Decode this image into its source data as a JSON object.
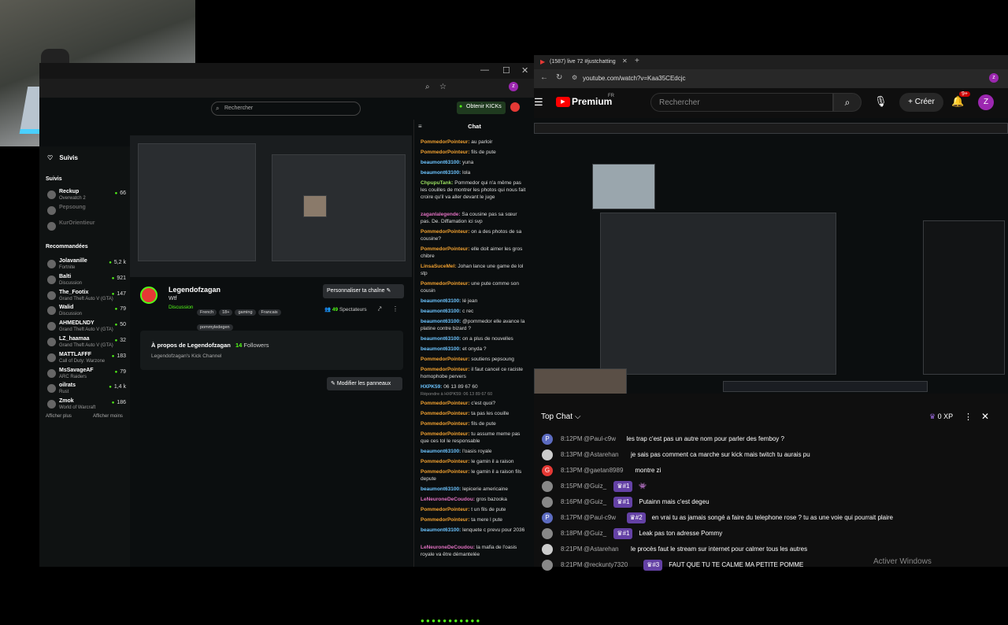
{
  "kick": {
    "search_placeholder": "Rechercher",
    "obtain_button": "Obtenir KICKs",
    "following_header": "Suivis",
    "following_section": "Suivis",
    "following": [
      {
        "name": "Reckup",
        "game": "Overwatch 2",
        "count": "66"
      },
      {
        "name": "Pepsoung",
        "game": "",
        "count": ""
      },
      {
        "name": "KurOrientieur",
        "game": "",
        "count": ""
      }
    ],
    "recommended_title": "Recommandées",
    "recommended": [
      {
        "name": "Jolavanille",
        "game": "Fortnite",
        "count": "5,2 k"
      },
      {
        "name": "Balti",
        "game": "Discussion",
        "count": "921"
      },
      {
        "name": "The_Footix",
        "game": "Grand Theft Auto V (GTA)",
        "count": "147"
      },
      {
        "name": "Walid",
        "game": "Discussion",
        "count": "79"
      },
      {
        "name": "AHMEDLNDY",
        "game": "Grand Theft Auto V (GTA)",
        "count": "50"
      },
      {
        "name": "LZ_haamaa",
        "game": "Grand Theft Auto V (GTA)",
        "count": "32"
      },
      {
        "name": "MATTLAFFF",
        "game": "Call of Duty: Warzone",
        "count": "183"
      },
      {
        "name": "MsSavageAF",
        "game": "ARC Raiders",
        "count": "79"
      },
      {
        "name": "oilrats",
        "game": "Rust",
        "count": "1,4 k"
      },
      {
        "name": "Zmok",
        "game": "World of Warcraft",
        "count": "186"
      }
    ],
    "show_more": "Afficher plus",
    "show_less": "Afficher moins",
    "channel_name": "Legendofzagan",
    "channel_sub": "Wtf",
    "category": "Discussion",
    "tags": [
      "French",
      "18+",
      "gaming",
      "Francais",
      "pommyledegen"
    ],
    "customize_button": "Personnaliser ta chaîne",
    "viewers": "49",
    "viewers_label": "Spectateurs",
    "about_title": "À propos de Legendofzagan",
    "followers_count": "14",
    "followers_label": "Followers",
    "about_desc": "Legendofzagan's Kick Channel",
    "edit_panels": "Modifier les panneaux",
    "chat_title": "Chat",
    "chat": [
      {
        "user": "PommedorPointeur",
        "msg": "au parloir",
        "c": "u1"
      },
      {
        "user": "PommedorPointeur",
        "msg": "fils de pute",
        "c": "u1"
      },
      {
        "user": "beaumont63100",
        "msg": "yuna",
        "c": "u3"
      },
      {
        "user": "beaumont63100",
        "msg": "lola",
        "c": "u3"
      },
      {
        "user": "ChpupuTank",
        "msg": "Pommedor qui n'a même pas les couilles de montrer les photos qui nous fait croire qu'il va aller devant le juge",
        "c": "u2"
      },
      {
        "user": "zaganlalegende",
        "msg": "Sa cousine pas sa sœur pas. De. Diffamation ici svp",
        "c": "u4"
      },
      {
        "user": "PommedorPointeur",
        "msg": "on a des photos de sa cousine?",
        "c": "u1"
      },
      {
        "user": "PommedorPointeur",
        "msg": "elle doit aimer les gros chibre",
        "c": "u1"
      },
      {
        "user": "LinsaSuceMel",
        "msg": "Johan lance une game de lol stp",
        "c": "u1"
      },
      {
        "user": "PommedorPointeur",
        "msg": "une pute comme son cousin",
        "c": "u1"
      },
      {
        "user": "beaumont63100",
        "msg": "lé jean",
        "c": "u3"
      },
      {
        "user": "beaumont63100",
        "msg": "c rec",
        "c": "u3"
      },
      {
        "user": "beaumont63100",
        "msg": "@pommedor elle avance la platine contre bizard ?",
        "c": "u3"
      },
      {
        "user": "beaumont63100",
        "msg": "on a plus de nouvelles",
        "c": "u3"
      },
      {
        "user": "beaumont63100",
        "msg": "et onyda ?",
        "c": "u3"
      },
      {
        "user": "PommedorPointeur",
        "msg": "soutiens pepsoung",
        "c": "u1"
      },
      {
        "user": "PommedorPointeur",
        "msg": "il faut cancel ce raciste homophobe pervers",
        "c": "u1"
      },
      {
        "user": "HXPK59",
        "msg": "06 13 89 67 60",
        "c": "u3"
      },
      {
        "user": "PommedorPointeur",
        "msg": "c'est quoi?",
        "c": "u1"
      },
      {
        "user": "PommedorPointeur",
        "msg": "ta pas les couille",
        "c": "u1"
      },
      {
        "user": "PommedorPointeur",
        "msg": "fils de pute",
        "c": "u1"
      },
      {
        "user": "PommedorPointeur",
        "msg": "tu assume meme pas que ces tol le responsable",
        "c": "u1"
      },
      {
        "user": "beaumont63100",
        "msg": "l'oasis royale",
        "c": "u3"
      },
      {
        "user": "PommedorPointeur",
        "msg": "le gamin il a raison",
        "c": "u1"
      },
      {
        "user": "PommedorPointeur",
        "msg": "le gamin il a raison fils depute",
        "c": "u1"
      },
      {
        "user": "beaumont63100",
        "msg": "lepicerie americaine",
        "c": "u3"
      },
      {
        "user": "LeNeuroneDeCoudou",
        "msg": "gros bazooka",
        "c": "u4"
      },
      {
        "user": "PommedorPointeur",
        "msg": "t un fils de pute",
        "c": "u1"
      },
      {
        "user": "PommedorPointeur",
        "msg": "ta mere l pute",
        "c": "u1"
      },
      {
        "user": "beaumont63100",
        "msg": "lenquete c prevu pour 2036",
        "c": "u3"
      },
      {
        "user": "LeNeuroneDeCoudou",
        "msg": "la mafia de l'oasis royale va être démantelée",
        "c": "u4"
      }
    ],
    "reply_note": "Répondre à HXPK59: 06 13 89 67 60"
  },
  "youtube": {
    "tab_title": "(1587) live 72 #justchatting",
    "url": "youtube.com/watch?v=Kaa35CEdcjc",
    "logo": "Premium",
    "logo_region": "FR",
    "search_placeholder": "Rechercher",
    "create_button": "Créer",
    "notif_count": "9+",
    "avatar_letter": "Z",
    "topchat_label": "Top Chat",
    "xp_label": "0 XP",
    "messages": [
      {
        "time": "8:12PM",
        "author": "@Paul-c9w",
        "badge": "",
        "text": "les trap c'est pas un autre nom pour parler des femboy ?",
        "av": "P",
        "avc": "#5c6bc0"
      },
      {
        "time": "8:13PM",
        "author": "@Astarehan",
        "badge": "",
        "text": "je sais pas comment ca marche sur kick mais twitch tu aurais pu",
        "av": "",
        "avc": "#ccc"
      },
      {
        "time": "8:13PM",
        "author": "@gaetan8989",
        "badge": "",
        "text": "montre zi",
        "av": "G",
        "avc": "#e53935"
      },
      {
        "time": "8:15PM",
        "author": "@Guiz_",
        "badge": "#1",
        "text": "👾",
        "av": "",
        "avc": "#888"
      },
      {
        "time": "8:16PM",
        "author": "@Guiz_",
        "badge": "#1",
        "text": "Putainn mais c'est degeu",
        "av": "",
        "avc": "#888"
      },
      {
        "time": "8:17PM",
        "author": "@Paul-c9w",
        "badge": "#2",
        "text": "en vrai tu as jamais songé a faire du telephone rose ? tu as une voie qui pourrait plaire",
        "av": "P",
        "avc": "#5c6bc0"
      },
      {
        "time": "8:18PM",
        "author": "@Guiz_",
        "badge": "#1",
        "text": "Leak pas ton adresse Pommy",
        "av": "",
        "avc": "#888"
      },
      {
        "time": "8:21PM",
        "author": "@Astarehan",
        "badge": "",
        "text": "le procès faut le stream sur internet pour calmer tous les autres",
        "av": "",
        "avc": "#ccc"
      },
      {
        "time": "8:21PM",
        "author": "@reckunty7320",
        "badge": "#3",
        "text": "FAUT QUE TU TE CALME MA PETITE POMME",
        "av": "",
        "avc": "#888"
      }
    ]
  },
  "overlay": {
    "activate_windows": "Activer Windows"
  }
}
